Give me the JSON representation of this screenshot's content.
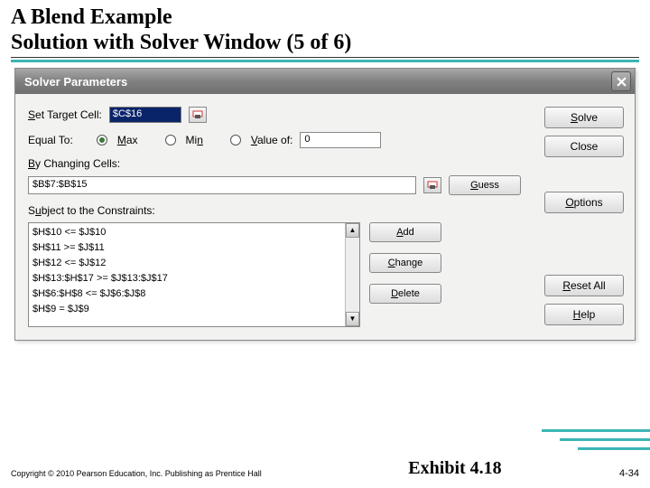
{
  "slide": {
    "title_line1": "A Blend Example",
    "title_line2": "Solution with Solver Window (5 of 6)"
  },
  "dialog": {
    "title": "Solver Parameters",
    "set_target_label": "Set Target Cell:",
    "target_value": "$C$16",
    "equal_to_label": "Equal To:",
    "radio_max": "Max",
    "radio_min": "Min",
    "radio_value": "Value of:",
    "value_input": "0",
    "changing_label": "By Changing Cells:",
    "changing_value": "$B$7:$B$15",
    "subject_label": "Subject to the Constraints:",
    "constraints": [
      "$H$10 <= $J$10",
      "$H$11 >= $J$11",
      "$H$12 <= $J$12",
      "$H$13:$H$17 >= $J$13:$J$17",
      "$H$6:$H$8 <= $J$6:$J$8",
      "$H$9 = $J$9"
    ],
    "buttons": {
      "solve": "Solve",
      "close": "Close",
      "guess": "Guess",
      "options": "Options",
      "add": "Add",
      "change": "Change",
      "delete": "Delete",
      "reset": "Reset All",
      "help": "Help"
    }
  },
  "footer": {
    "copyright": "Copyright © 2010 Pearson Education, Inc. Publishing as Prentice Hall",
    "exhibit": "Exhibit 4.18",
    "pagenum": "4-34"
  }
}
